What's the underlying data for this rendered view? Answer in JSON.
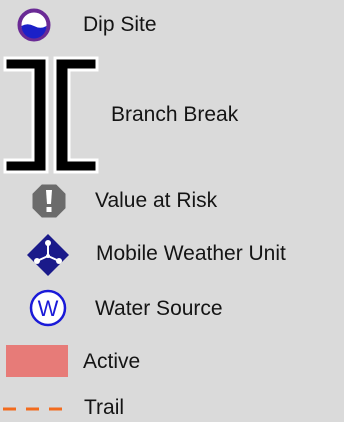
{
  "legend": {
    "items": [
      {
        "label": "Dip Site",
        "icon": "dip-site-icon"
      },
      {
        "label": "Branch Break",
        "icon": "branch-break-icon"
      },
      {
        "label": "Value at Risk",
        "icon": "value-at-risk-icon"
      },
      {
        "label": "Mobile Weather Unit",
        "icon": "mobile-weather-unit-icon"
      },
      {
        "label": "Water Source",
        "icon": "water-source-icon",
        "glyph": "W"
      },
      {
        "label": "Active",
        "icon": "active-swatch"
      },
      {
        "label": "Trail",
        "icon": "trail-line"
      }
    ],
    "colors": {
      "background": "#dadada",
      "text": "#141414",
      "dip_site_ring": "#6a2a95",
      "dip_site_water": "#1b20c8",
      "branch_break_fill": "#000000",
      "branch_break_outline": "#ffffff",
      "value_at_risk": "#6b6b6b",
      "mobile_weather_unit": "#1a1a8a",
      "water_source": "#1a1ad8",
      "active": "#e77b78",
      "trail": "#f26b1d"
    }
  }
}
